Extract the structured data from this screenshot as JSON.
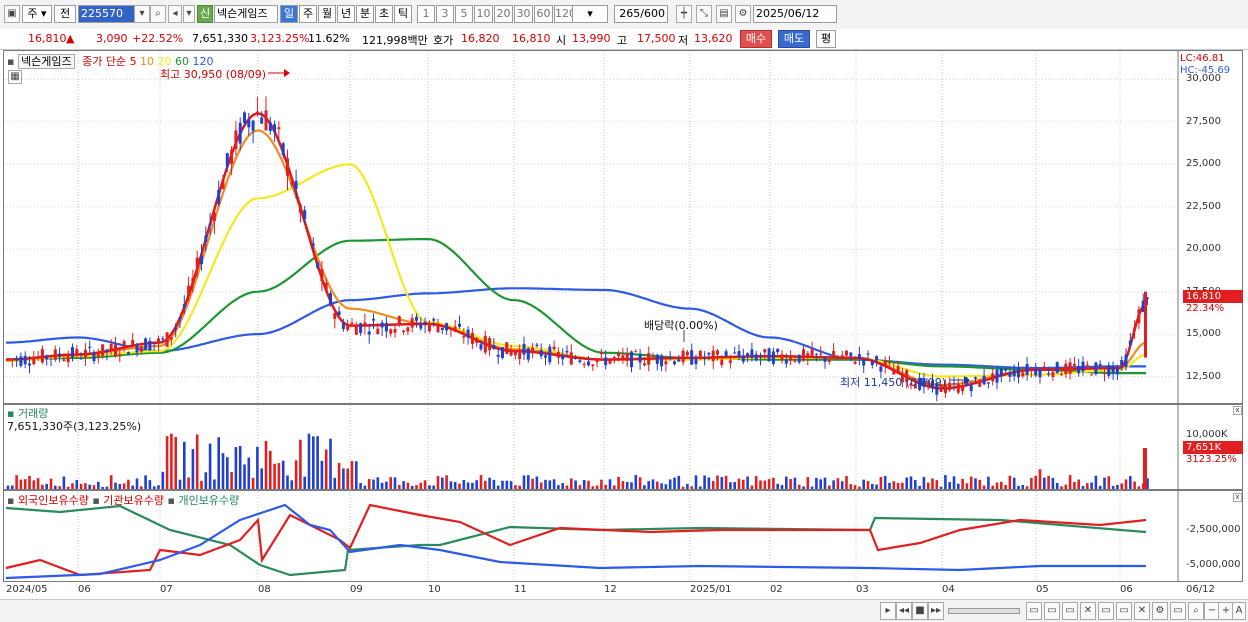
{
  "toolbar": {
    "market": "주",
    "prev_label": "전",
    "code": "225570",
    "sin_badge": "신",
    "name": "넥슨게임즈",
    "periods": [
      "일",
      "주",
      "월",
      "년",
      "분",
      "초",
      "틱"
    ],
    "intervals": [
      "1",
      "3",
      "5",
      "10",
      "20",
      "30",
      "60",
      "120"
    ],
    "count": "265",
    "count_total": "/600",
    "date": "2025/06/12"
  },
  "quote": {
    "price": "16,810",
    "arrow": "▲",
    "change": "3,090",
    "change_pct": "+22.52%",
    "volume": "7,651,330",
    "volume_ratio": "3,123.25%",
    "turnover": "11.62%",
    "amount": "121,998백만",
    "hoga_label": "호가",
    "ask": "16,820",
    "bid": "16,810",
    "open_label": "시",
    "open": "13,990",
    "high_label": "고",
    "high": "17,500",
    "low_label": "저",
    "low": "13,620",
    "buy": "매수",
    "sell": "매도",
    "eval": "평"
  },
  "price_panel": {
    "title": "넥슨게임즈",
    "ma_label": "종가 단순",
    "ma_periods": [
      "5",
      "10",
      "20",
      "60",
      "120"
    ],
    "ma_colors": [
      "#e01818",
      "#f08c1e",
      "#f5e81e",
      "#1e9632",
      "#2d5ae6"
    ],
    "high_marker": "최고 30,950 (08/09)",
    "low_marker": "최저 11,450 (04/09)",
    "dividend": "배당락(0.00%)",
    "lc": "LC:46.81",
    "hc": "HC:-45.69",
    "current_price": "16,810",
    "current_pct": "22.34%",
    "y_ticks": [
      "30,000",
      "27,500",
      "25,000",
      "22,500",
      "20,000",
      "17,500",
      "15,000",
      "12,500"
    ]
  },
  "volume_panel": {
    "title": "거래량",
    "summary": "7,651,330주(3,123.25%)",
    "y_tick": "10,000K",
    "current": "7,651K",
    "current_pct": "3123.25%"
  },
  "holder_panel": {
    "foreign": "외국인보유수량",
    "institution": "기관보유수량",
    "individual": "개인보유수량",
    "y_ticks": [
      "-2,500,000",
      "-5,000,000"
    ]
  },
  "x_axis": {
    "labels": [
      "2024/05",
      "06",
      "07",
      "08",
      "09",
      "10",
      "11",
      "12",
      "2025/01",
      "02",
      "03",
      "04",
      "05",
      "06",
      "06/12"
    ]
  },
  "chart_data": {
    "type": "line",
    "title": "넥슨게임즈",
    "x": [
      "2024/05",
      "06",
      "07",
      "08",
      "09",
      "10",
      "11",
      "12",
      "2025/01",
      "02",
      "03",
      "04",
      "05",
      "06",
      "06/12"
    ],
    "ylim": [
      11000,
      31500
    ],
    "series": [
      {
        "name": "5",
        "values": [
          13500,
          13800,
          14500,
          28000,
          15500,
          15600,
          14000,
          13500,
          13600,
          13700,
          13600,
          11800,
          12900,
          13000,
          16810
        ]
      },
      {
        "name": "10",
        "values": [
          13500,
          13800,
          14300,
          27000,
          16500,
          15600,
          14100,
          13500,
          13600,
          13700,
          13600,
          12000,
          12900,
          13000,
          14500
        ]
      },
      {
        "name": "20",
        "values": [
          13400,
          13700,
          14000,
          23000,
          25000,
          15700,
          14300,
          13500,
          13500,
          13600,
          13600,
          12500,
          12600,
          12900,
          13800
        ]
      },
      {
        "name": "60",
        "values": [
          13500,
          13600,
          13900,
          17500,
          20500,
          20600,
          17000,
          13900,
          13600,
          13500,
          13500,
          13100,
          12900,
          12700,
          12700
        ]
      },
      {
        "name": "120",
        "values": [
          14500,
          14800,
          14000,
          15000,
          17000,
          17400,
          17700,
          17600,
          16500,
          14800,
          13500,
          13200,
          13000,
          13100,
          13100
        ]
      }
    ]
  }
}
